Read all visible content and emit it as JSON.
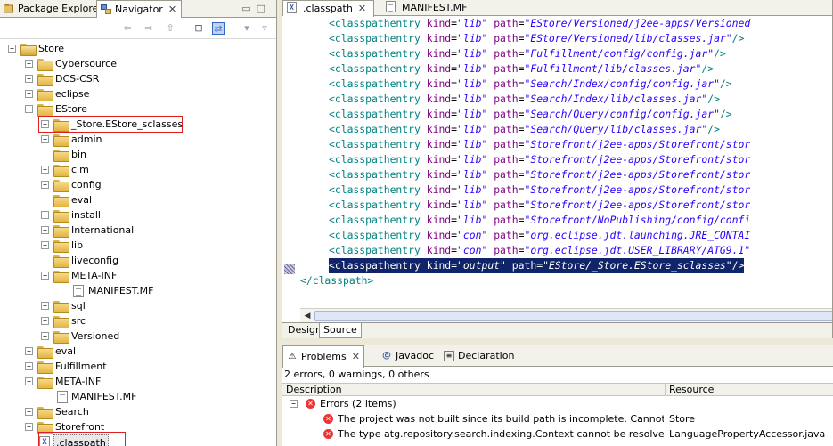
{
  "left_panel": {
    "tabs": [
      {
        "label": "Package Explorer",
        "icon": "package-explorer-icon",
        "active": false
      },
      {
        "label": "Navigator",
        "icon": "navigator-icon",
        "active": true
      }
    ],
    "tree": [
      {
        "label": "Store",
        "icon": "project-icon",
        "expanded": true
      },
      {
        "label": "Cybersource",
        "icon": "folder-icon",
        "expanded": false
      },
      {
        "label": "DCS-CSR",
        "icon": "folder-icon",
        "expanded": false
      },
      {
        "label": "eclipse",
        "icon": "folder-icon",
        "expanded": false
      },
      {
        "label": "EStore",
        "icon": "folder-icon",
        "expanded": true
      },
      {
        "label": "_Store.EStore_sclasses",
        "icon": "folder-icon",
        "expanded": false,
        "highlighted": true
      },
      {
        "label": "admin",
        "icon": "folder-icon",
        "expanded": false
      },
      {
        "label": "bin",
        "icon": "folder-icon",
        "expanded": null
      },
      {
        "label": "cim",
        "icon": "folder-icon",
        "expanded": false
      },
      {
        "label": "config",
        "icon": "folder-icon",
        "expanded": false
      },
      {
        "label": "eval",
        "icon": "folder-icon",
        "expanded": null
      },
      {
        "label": "install",
        "icon": "folder-icon",
        "expanded": false
      },
      {
        "label": "International",
        "icon": "folder-icon",
        "expanded": false
      },
      {
        "label": "lib",
        "icon": "folder-icon",
        "expanded": false
      },
      {
        "label": "liveconfig",
        "icon": "folder-icon",
        "expanded": null
      },
      {
        "label": "META-INF",
        "icon": "folder-icon",
        "expanded": true
      },
      {
        "label": "MANIFEST.MF",
        "icon": "file-icon",
        "expanded": null
      },
      {
        "label": "sql",
        "icon": "folder-icon",
        "expanded": false
      },
      {
        "label": "src",
        "icon": "folder-icon",
        "expanded": false
      },
      {
        "label": "Versioned",
        "icon": "folder-icon",
        "expanded": false
      },
      {
        "label": "eval",
        "icon": "folder-icon",
        "expanded": false
      },
      {
        "label": "Fulfillment",
        "icon": "folder-icon",
        "expanded": false
      },
      {
        "label": "META-INF",
        "icon": "folder-icon",
        "expanded": true
      },
      {
        "label": "MANIFEST.MF",
        "icon": "file-icon",
        "expanded": null
      },
      {
        "label": "Search",
        "icon": "folder-icon",
        "expanded": false
      },
      {
        "label": "Storefront",
        "icon": "folder-icon",
        "expanded": false
      },
      {
        "label": ".classpath",
        "icon": "xml-file-icon",
        "expanded": null,
        "highlighted": true,
        "selected": true
      }
    ]
  },
  "editor": {
    "tabs": [
      {
        "label": ".classpath",
        "icon": "xml-file-icon",
        "active": true
      },
      {
        "label": "MANIFEST.MF",
        "icon": "file-icon",
        "active": false
      }
    ],
    "lines": [
      {
        "tag": "<classpathentry",
        "kind": "\"lib\"",
        "path": "\"EStore/Versioned/j2ee-apps/Versioned"
      },
      {
        "tag": "<classpathentry",
        "kind": "\"lib\"",
        "path": "\"EStore/Versioned/lib/classes.jar\"",
        "end": "/>"
      },
      {
        "tag": "<classpathentry",
        "kind": "\"lib\"",
        "path": "\"Fulfillment/config/config.jar\"",
        "end": "/>"
      },
      {
        "tag": "<classpathentry",
        "kind": "\"lib\"",
        "path": "\"Fulfillment/lib/classes.jar\"",
        "end": "/>"
      },
      {
        "tag": "<classpathentry",
        "kind": "\"lib\"",
        "path": "\"Search/Index/config/config.jar\"",
        "end": "/>"
      },
      {
        "tag": "<classpathentry",
        "kind": "\"lib\"",
        "path": "\"Search/Index/lib/classes.jar\"",
        "end": "/>"
      },
      {
        "tag": "<classpathentry",
        "kind": "\"lib\"",
        "path": "\"Search/Query/config/config.jar\"",
        "end": "/>"
      },
      {
        "tag": "<classpathentry",
        "kind": "\"lib\"",
        "path": "\"Search/Query/lib/classes.jar\"",
        "end": "/>"
      },
      {
        "tag": "<classpathentry",
        "kind": "\"lib\"",
        "path": "\"Storefront/j2ee-apps/Storefront/stor"
      },
      {
        "tag": "<classpathentry",
        "kind": "\"lib\"",
        "path": "\"Storefront/j2ee-apps/Storefront/stor"
      },
      {
        "tag": "<classpathentry",
        "kind": "\"lib\"",
        "path": "\"Storefront/j2ee-apps/Storefront/stor"
      },
      {
        "tag": "<classpathentry",
        "kind": "\"lib\"",
        "path": "\"Storefront/j2ee-apps/Storefront/stor"
      },
      {
        "tag": "<classpathentry",
        "kind": "\"lib\"",
        "path": "\"Storefront/j2ee-apps/Storefront/stor"
      },
      {
        "tag": "<classpathentry",
        "kind": "\"lib\"",
        "path": "\"Storefront/NoPublishing/config/confi"
      },
      {
        "tag": "<classpathentry",
        "kind": "\"con\"",
        "path": "\"org.eclipse.jdt.launching.JRE_CONTAI"
      },
      {
        "tag": "<classpathentry",
        "kind": "\"con\"",
        "path": "\"org.eclipse.jdt.USER_LIBRARY/ATG9.1\""
      },
      {
        "tag": "<classpathentry",
        "kind": "\"output\"",
        "path": "\"EStore/_Store.EStore_sclasses\"",
        "end": "/>",
        "selected": true
      }
    ],
    "closing_tag": "</classpath>",
    "attr_kind": "kind",
    "attr_path": "path",
    "bottom_tabs": [
      "Design",
      "Source"
    ]
  },
  "problems_panel": {
    "tabs": [
      {
        "label": "Problems",
        "icon": "problems-icon",
        "active": true
      },
      {
        "label": "Javadoc",
        "icon": "javadoc-icon",
        "active": false
      },
      {
        "label": "Declaration",
        "icon": "declaration-icon",
        "active": false
      }
    ],
    "summary": "2 errors, 0 warnings, 0 others",
    "columns": [
      "Description",
      "Resource"
    ],
    "group_label": "Errors (2 items)",
    "errors": [
      {
        "description": "The project was not built since its build path is incomplete. Cannot find the cl",
        "resource": "Store"
      },
      {
        "description": "The type atg.repository.search.indexing.Context cannot be resolved. It is in",
        "resource": "LanguagePropertyAccessor.java"
      }
    ]
  },
  "colors": {
    "tag": "#008080",
    "attribute": "#7f007f",
    "value": "#2a00ff",
    "selection": "#10246a",
    "highlight_box": "#e02020",
    "error": "#e33333"
  }
}
